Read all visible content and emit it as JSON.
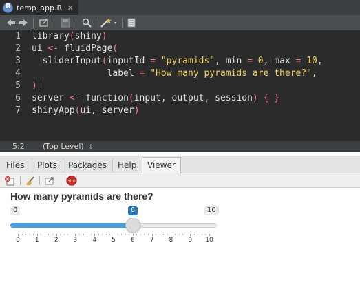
{
  "editor_tab": {
    "filename": "temp_app.R",
    "close": "×"
  },
  "code_lines": [
    {
      "num": "1",
      "text": "library(shiny)"
    },
    {
      "num": "2",
      "text": "ui <- fluidPage("
    },
    {
      "num": "3",
      "text": "  sliderInput(inputId = \"pyramids\", min = 0, max = 10,"
    },
    {
      "num": "4",
      "text": "              label = \"How many pyramids are there?\","
    },
    {
      "num": "5",
      "text": ")"
    },
    {
      "num": "6",
      "text": "server <- function(input, output, session) { }"
    },
    {
      "num": "7",
      "text": "shinyApp(ui, server)"
    }
  ],
  "status": {
    "position": "5:2",
    "scope": "(Top Level)",
    "scope_arrow": "⇕"
  },
  "pane_tabs": [
    "Files",
    "Plots",
    "Packages",
    "Help",
    "Viewer"
  ],
  "active_pane_tab": "Viewer",
  "slider": {
    "label": "How many pyramids are there?",
    "min_label": "0",
    "max_label": "10",
    "value_label": "6",
    "min": 0,
    "max": 10,
    "value": 6,
    "ticks": [
      "0",
      "1",
      "2",
      "3",
      "4",
      "5",
      "6",
      "7",
      "8",
      "9",
      "10"
    ],
    "fill_color": "#4a9fdc",
    "value_badge_color": "#2a74b8"
  },
  "icons": {
    "toolbar": [
      "back-arrow-icon",
      "forward-arrow-icon",
      "open-in-window-icon",
      "save-icon",
      "search-icon",
      "magic-wand-icon",
      "compile-report-icon"
    ],
    "viewer_toolbar": [
      "remove-viewer-icon",
      "clear-all-icon",
      "popout-window-icon",
      "stop-icon"
    ]
  }
}
